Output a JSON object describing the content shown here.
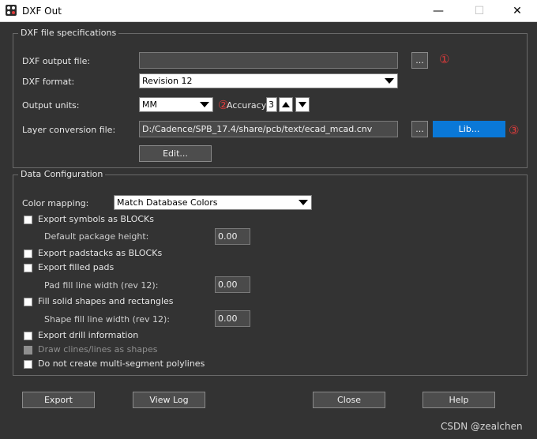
{
  "window": {
    "title": "DXF Out",
    "min": "—",
    "max": "☐",
    "close": "✕"
  },
  "spec": {
    "group_title": "DXF file specifications",
    "output_file_label": "DXF output file:",
    "output_file_value": "",
    "browse1": "...",
    "mark1": "①",
    "format_label": "DXF format:",
    "format_value": "Revision 12",
    "units_label": "Output units:",
    "units_value": "MM",
    "mark2": "②",
    "accuracy_label": "Accuracy:",
    "accuracy_value": "3",
    "layer_label": "Layer conversion file:",
    "layer_value": "D:/Cadence/SPB_17.4/share/pcb/text/ecad_mcad.cnv",
    "browse2": "...",
    "lib": "Lib...",
    "mark3": "③",
    "edit": "Edit..."
  },
  "config": {
    "group_title": "Data Configuration",
    "color_label": "Color mapping:",
    "color_value": "Match Database Colors",
    "items": {
      "symbols": "Export symbols as BLOCKs",
      "pkg_height": "Default package height:",
      "pkg_height_value": "0.00",
      "padstacks": "Export padstacks as BLOCKs",
      "filled_pads": "Export filled pads",
      "pad_fill": "Pad fill line width (rev 12):",
      "pad_fill_value": "0.00",
      "fill_solid": "Fill solid shapes and rectangles",
      "shape_fill": "Shape fill line width (rev 12):",
      "shape_fill_value": "0.00",
      "drill": "Export drill information",
      "clines": "Draw clines/lines as shapes",
      "polylines": "Do not create multi-segment polylines"
    }
  },
  "buttons": {
    "export": "Export",
    "view_log": "View Log",
    "close": "Close",
    "help": "Help"
  },
  "watermark": "CSDN @zealchen"
}
